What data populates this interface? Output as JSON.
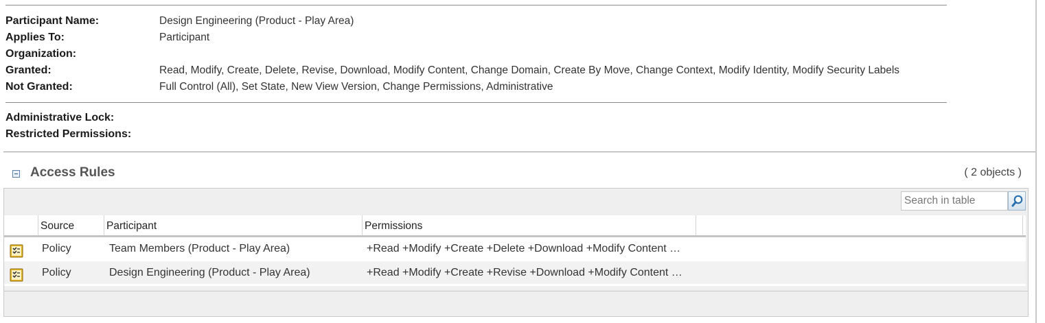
{
  "details": {
    "participant_name": {
      "label": "Participant Name:",
      "value": "Design Engineering (Product - Play Area)"
    },
    "applies_to": {
      "label": "Applies To:",
      "value": "Participant"
    },
    "organization": {
      "label": "Organization:",
      "value": ""
    },
    "granted": {
      "label": "Granted:",
      "value": "Read, Modify, Create, Delete, Revise, Download, Modify Content, Change Domain, Create By Move, Change Context, Modify Identity, Modify Security Labels"
    },
    "not_granted": {
      "label": "Not Granted:",
      "value": "Full Control (All), Set State, New View Version, Change Permissions, Administrative"
    },
    "administrative_lock": {
      "label": "Administrative Lock:",
      "value": ""
    },
    "restricted_permissions": {
      "label": "Restricted Permissions:",
      "value": ""
    }
  },
  "access_rules": {
    "title": "Access Rules",
    "count": "( 2 objects )",
    "search": {
      "placeholder": "Search in table",
      "value": ""
    },
    "columns": [
      "Source",
      "Participant",
      "Permissions"
    ],
    "rows": [
      {
        "icon": "policy-icon",
        "source": "Policy",
        "participant": "Team Members (Product - Play Area)",
        "permissions": "+Read +Modify +Create +Delete +Download +Modify Content …"
      },
      {
        "icon": "policy-icon",
        "source": "Policy",
        "participant": "Design Engineering (Product - Play Area)",
        "permissions": "+Read +Modify +Create +Revise +Download +Modify Content …"
      }
    ]
  },
  "colors": {
    "accent": "#2a6fb0",
    "icon_gold": "#e6b422",
    "header_line": "#c4c4c4"
  }
}
